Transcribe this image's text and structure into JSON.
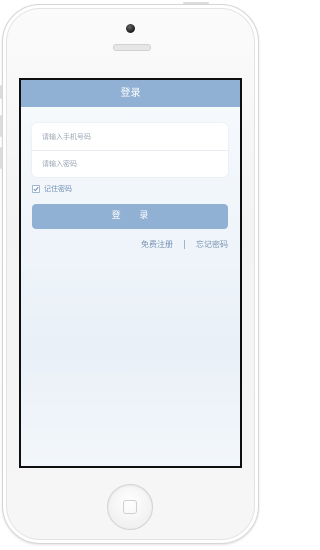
{
  "nav": {
    "title": "登录"
  },
  "form": {
    "phone_placeholder": "请输入手机号码",
    "password_placeholder": "请输入密码",
    "remember_label": "记住密码",
    "remember_checked": true
  },
  "actions": {
    "login_label": "登 录",
    "register_label": "免费注册",
    "forgot_label": "忘记密码"
  },
  "colors": {
    "accent": "#90b1d4",
    "link": "#7893b2"
  },
  "icons": {
    "remember": "checkmark-icon",
    "home": "home-square-icon"
  }
}
